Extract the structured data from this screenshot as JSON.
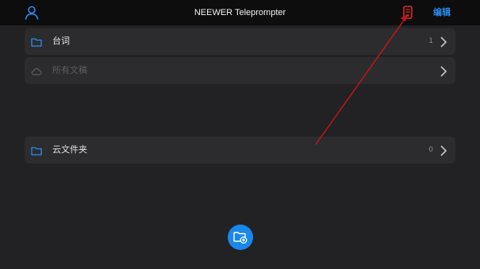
{
  "header": {
    "title": "NEEWER Teleprompter",
    "edit_label": "编辑",
    "left_icon": "user-icon",
    "right_icon": "teleprompter-device-icon"
  },
  "folders": [
    {
      "label": "台词",
      "count": "1",
      "icon": "folder-icon",
      "disabled": false
    },
    {
      "label": "所有文稿",
      "count": "",
      "icon": "cloud-icon",
      "disabled": true
    },
    {
      "label": "云文件夹",
      "count": "0",
      "icon": "folder-icon",
      "disabled": false
    }
  ],
  "fab": {
    "icon": "add-folder-icon"
  },
  "colors": {
    "accent": "#1b87ea",
    "header_bg": "#0d0d0e",
    "page_bg": "#222224",
    "row_bg": "#2c2c2e",
    "annotation_arrow": "#c8151b"
  }
}
